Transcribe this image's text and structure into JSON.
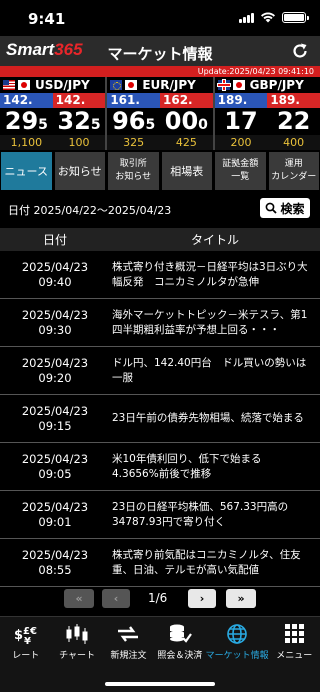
{
  "status": {
    "time": "9:41"
  },
  "header": {
    "logo_text": "Smart",
    "logo_num": "365",
    "title": "マーケット情報",
    "update": "Update:2025/04/23 09:41:10"
  },
  "rates": [
    {
      "pair": "USD/JPY",
      "bid_big": "142.",
      "ask_big": "142.",
      "bid_pips": "29",
      "bid_frac": "5",
      "ask_pips": "32",
      "ask_frac": "5",
      "diff_low": "1,100",
      "diff_high": "100"
    },
    {
      "pair": "EUR/JPY",
      "bid_big": "161.",
      "ask_big": "162.",
      "bid_pips": "96",
      "bid_frac": "5",
      "ask_pips": "00",
      "ask_frac": "0",
      "diff_low": "325",
      "diff_high": "425"
    },
    {
      "pair": "GBP/JPY",
      "bid_big": "189.",
      "ask_big": "189.",
      "bid_pips": "17",
      "bid_frac": "",
      "ask_pips": "22",
      "ask_frac": "",
      "diff_low": "200",
      "diff_high": "400"
    }
  ],
  "nav_tabs": [
    {
      "label": "ニュース",
      "active": true
    },
    {
      "label": "お知らせ"
    },
    {
      "label": "取引所\nお知らせ"
    },
    {
      "label": "相場表"
    },
    {
      "label": "証拠金額\n一覧"
    },
    {
      "label": "運用\nカレンダー"
    }
  ],
  "filter": {
    "date_range": "日付 2025/04/22〜2025/04/23",
    "search_label": "検索"
  },
  "table": {
    "col_date": "日付",
    "col_title": "タイトル"
  },
  "news": [
    {
      "date": "2025/04/23",
      "time": "09:40",
      "title": "株式寄り付き概況－日経平均は3日ぶり大幅反発　コニカミノルタが急伸"
    },
    {
      "date": "2025/04/23",
      "time": "09:30",
      "title": "海外マーケットトピック－米テスラ、第1四半期粗利益率が予想上回る・・・"
    },
    {
      "date": "2025/04/23",
      "time": "09:20",
      "title": "ドル円、142.40円台　ドル買いの勢いは一服"
    },
    {
      "date": "2025/04/23",
      "time": "09:15",
      "title": "23日午前の債券先物相場、続落で始まる"
    },
    {
      "date": "2025/04/23",
      "time": "09:05",
      "title": "米10年債利回り、低下で始まる　4.3656%前後で推移"
    },
    {
      "date": "2025/04/23",
      "time": "09:01",
      "title": "23日の日経平均株価、567.33円高の34787.93円で寄り付く"
    },
    {
      "date": "2025/04/23",
      "time": "08:55",
      "title": "株式寄り前気配はコニカミノルタ、住友重、日油、テルモが高い気配値"
    }
  ],
  "pager": {
    "first": "«",
    "prev": "‹",
    "label": "1/6",
    "next": "›",
    "last": "»"
  },
  "tabbar": [
    {
      "label": "レート",
      "icon": "rate-icon"
    },
    {
      "label": "チャート",
      "icon": "chart-icon"
    },
    {
      "label": "新規注文",
      "icon": "order-icon"
    },
    {
      "label": "照会＆決済",
      "icon": "settle-icon"
    },
    {
      "label": "マーケット情報",
      "icon": "globe-icon",
      "active": true
    },
    {
      "label": "メニュー",
      "icon": "menu-icon"
    }
  ],
  "colors": {
    "accent": "#29a9e1",
    "bid": "#2b56b8",
    "ask": "#d72626",
    "diff": "#e9c13a",
    "active_tab": "#1f7a9c"
  }
}
